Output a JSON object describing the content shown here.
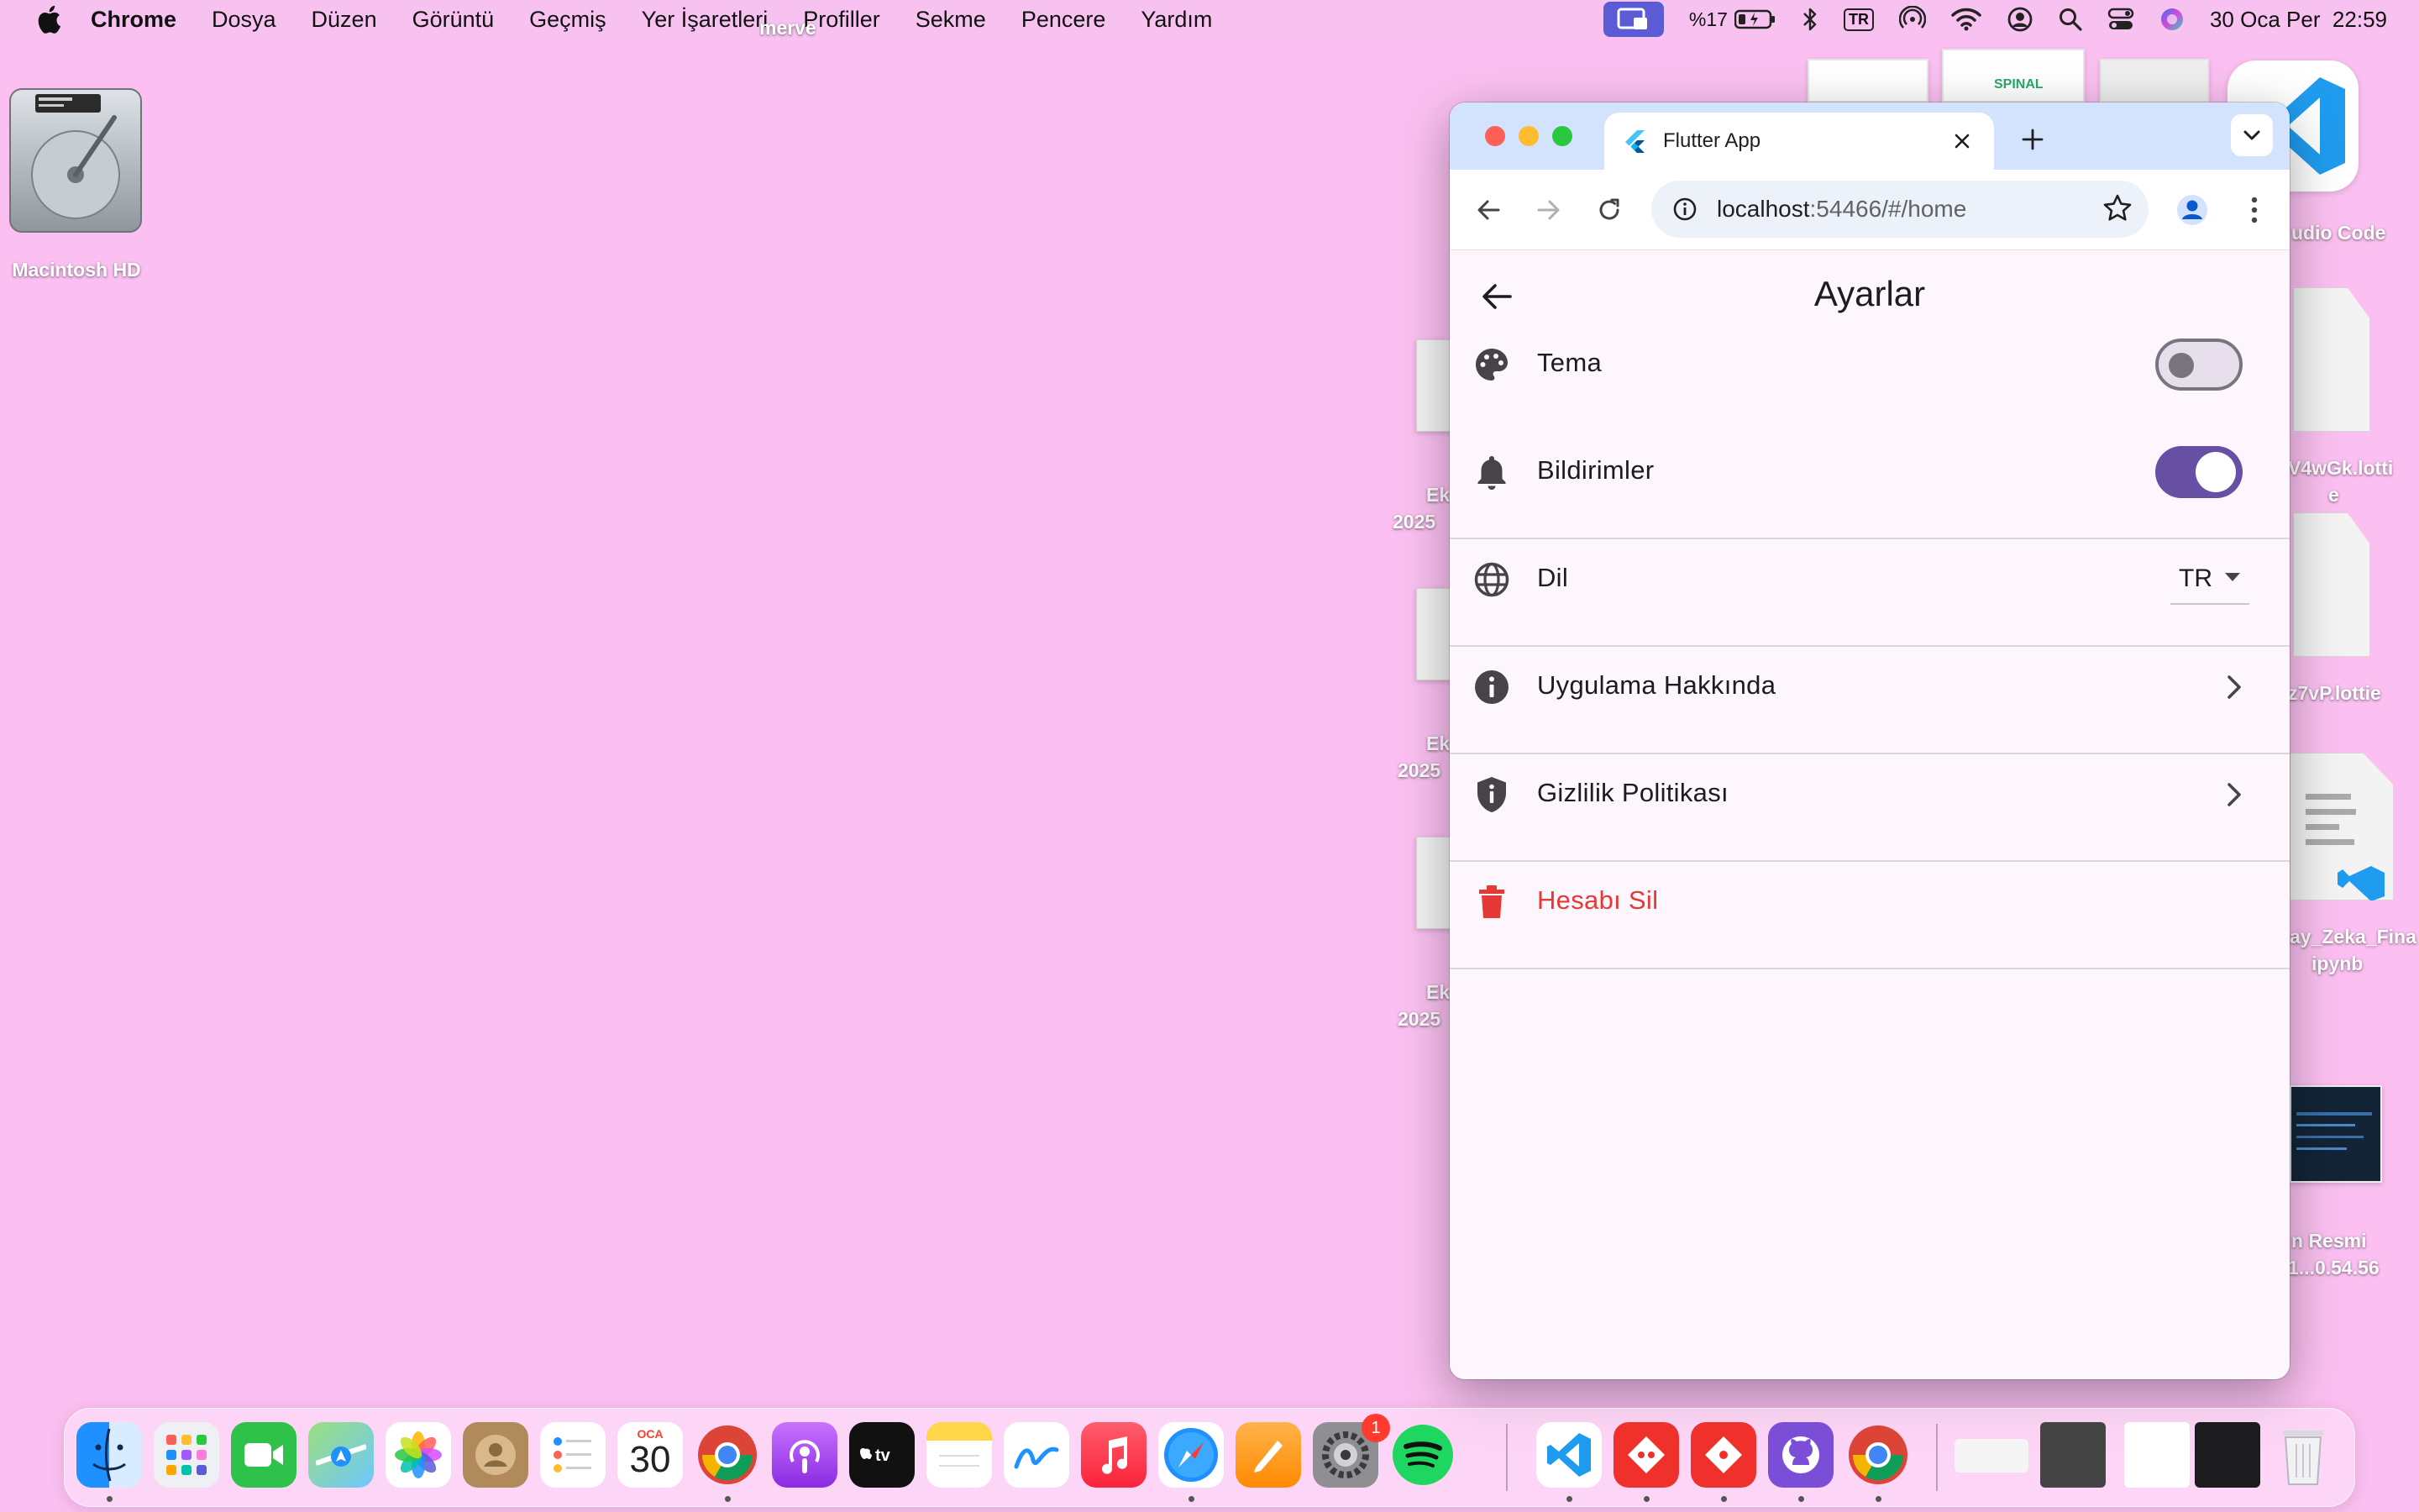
{
  "menubar": {
    "app_name": "Chrome",
    "items": [
      "Dosya",
      "Düzen",
      "Görüntü",
      "Geçmiş",
      "Yer İşaretleri",
      "Profiller",
      "Sekme",
      "Pencere",
      "Yardım"
    ],
    "battery": "%17",
    "keyboard": "TR",
    "clock": "30 Oca Per  22:59"
  },
  "desktop": {
    "hd_label": "Macintosh HD",
    "partial_labels": {
      "top_stray": "merve",
      "ek1_a": "Ek",
      "ek1_b": "2025",
      "ek2_a": "Ek",
      "ek2_b": "2025",
      "ek3_a": "Ek",
      "ek3_b": "2025",
      "vscode": "udio Code",
      "lottie1_a": "V4wGk.lotti",
      "lottie1_b": "e",
      "lottie2": "z7vP.lottie",
      "ipynb_a": "ay_Zeka_Fina",
      "ipynb_b": "ipynb",
      "screenshot_a": "n Resmi",
      "screenshot_b": "1...0.54.56"
    },
    "spinal_text": "SPINAL"
  },
  "browser": {
    "tab_title": "Flutter App",
    "url_host": "localhost",
    "url_rest": ":54466/#/home"
  },
  "app": {
    "title": "Ayarlar",
    "settings": [
      {
        "label": "Tema",
        "icon": "palette-icon",
        "control": "switch",
        "on": false
      },
      {
        "label": "Bildirimler",
        "icon": "bell-icon",
        "control": "switch",
        "on": true
      },
      {
        "label": "Dil",
        "icon": "globe-icon",
        "control": "dropdown",
        "value": "TR"
      },
      {
        "label": "Uygulama Hakkında",
        "icon": "info-icon",
        "control": "chevron"
      },
      {
        "label": "Gizlilik Politikası",
        "icon": "shield-icon",
        "control": "chevron"
      },
      {
        "label": "Hesabı Sil",
        "icon": "trash-icon",
        "control": "none",
        "danger": true
      }
    ]
  },
  "dock": {
    "calendar_month": "OCA",
    "calendar_day": "30",
    "settings_badge": "1",
    "apps": [
      "finder-icon",
      "launchpad-icon",
      "facetime-icon",
      "maps-icon",
      "photos-icon",
      "contacts-icon",
      "reminders-icon",
      "calendar-icon",
      "chrome-icon",
      "podcasts-icon",
      "appletv-icon",
      "notes-icon",
      "freeform-icon",
      "music-icon",
      "safari-icon",
      "pages-icon",
      "system-settings-icon",
      "spotify-icon",
      "vscode-icon",
      "git-client-icon",
      "git-client-2-icon",
      "github-desktop-icon",
      "chrome-2-icon",
      "trash-icon"
    ]
  },
  "colors": {
    "desktop": "#fbc0f1",
    "accent": "#6750a4",
    "danger": "#e53935",
    "chrome_frame": "#d3e3fd"
  }
}
